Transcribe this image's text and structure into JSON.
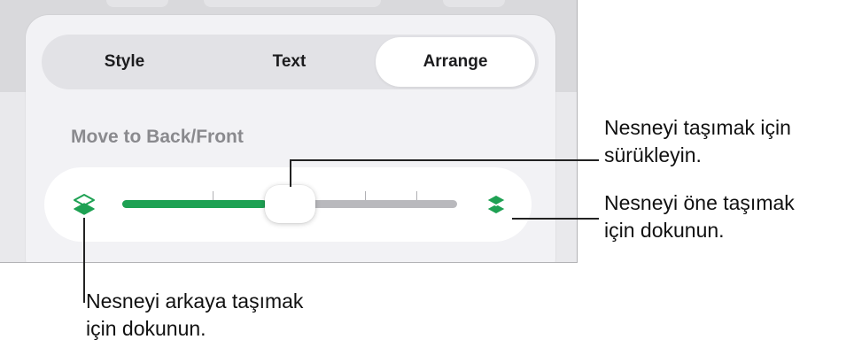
{
  "tabs": [
    {
      "label": "Style",
      "active": false
    },
    {
      "label": "Text",
      "active": false
    },
    {
      "label": "Arrange",
      "active": true
    }
  ],
  "section": {
    "title": "Move to Back/Front"
  },
  "slider": {
    "value": 0.43,
    "fill_color": "#1ea153",
    "tick_count": 6
  },
  "icons": {
    "back": "layers-back-icon",
    "front": "layers-front-icon",
    "accent_color": "#1ea153"
  },
  "callouts": {
    "drag": {
      "line1": "Nesneyi taşımak için",
      "line2": "sürükleyin."
    },
    "front": {
      "line1": "Nesneyi öne taşımak",
      "line2": "için dokunun."
    },
    "back": {
      "line1": "Nesneyi arkaya taşımak",
      "line2": "için dokunun."
    }
  }
}
